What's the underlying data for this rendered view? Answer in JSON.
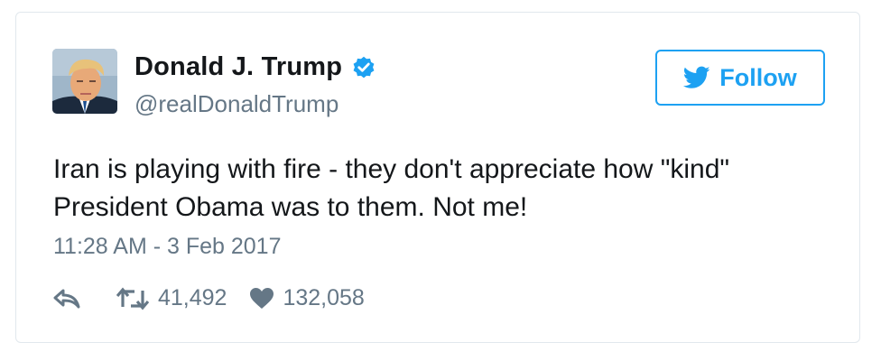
{
  "user": {
    "display_name": "Donald J. Trump",
    "handle": "@realDonaldTrump",
    "verified": true
  },
  "follow_button": {
    "label": "Follow"
  },
  "tweet": {
    "text": "Iran is playing with fire - they don't appreciate how \"kind\"\nPresident Obama was to them. Not me!",
    "timestamp": "11:28 AM - 3 Feb 2017"
  },
  "actions": {
    "retweet_count": "41,492",
    "like_count": "132,058"
  },
  "icons": {
    "reply": "reply-icon",
    "retweet": "retweet-icon",
    "like": "heart-icon",
    "verified": "verified-badge-icon",
    "follow": "twitter-bird-icon"
  },
  "colors": {
    "accent": "#1da1f2",
    "text": "#14171a",
    "secondary": "#657786",
    "border": "#e1e8ed"
  }
}
